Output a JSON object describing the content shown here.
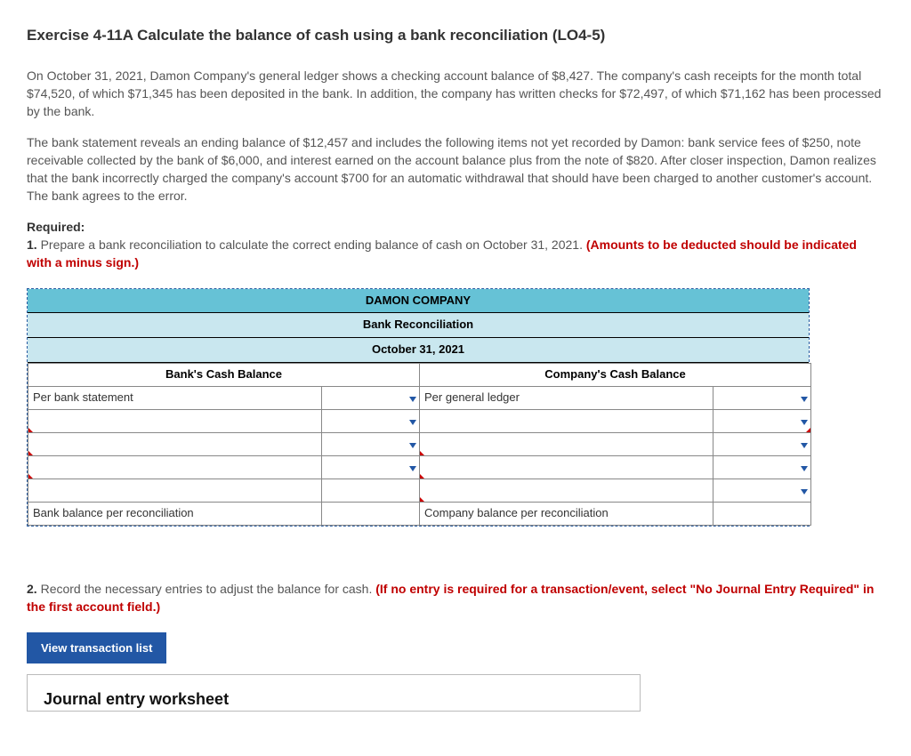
{
  "title": "Exercise 4-11A Calculate the balance of cash using a bank reconciliation (LO4-5)",
  "p1": "On October 31, 2021, Damon Company's general ledger shows a checking account balance of $8,427. The company's cash receipts for the month total $74,520, of which $71,345 has been deposited in the bank. In addition, the company has written checks for $72,497, of which $71,162 has been processed by the bank.",
  "p2": "The bank statement reveals an ending balance of $12,457 and includes the following items not yet recorded by Damon: bank service fees of $250, note receivable collected by the bank of $6,000, and interest earned on the account balance plus from the note of $820. After closer inspection, Damon realizes that the bank incorrectly charged the company's account $700 for an automatic withdrawal that should have been charged to another customer's account. The bank agrees to the error.",
  "required_label": "Required:",
  "req1_num": "1.",
  "req1_text": " Prepare a bank reconciliation to calculate the correct ending balance of cash on October 31, 2021. ",
  "req1_red": "(Amounts to be deducted should be indicated with a minus sign.)",
  "table": {
    "h1": "DAMON COMPANY",
    "h2": "Bank Reconciliation",
    "h3": "October 31, 2021",
    "col_bank": "Bank's Cash Balance",
    "col_company": "Company's Cash Balance",
    "row_bank_start": "Per bank statement",
    "row_company_start": "Per general ledger",
    "row_bank_end": "Bank balance per reconciliation",
    "row_company_end": "Company balance per reconciliation"
  },
  "req2_num": "2.",
  "req2_text": " Record the necessary entries to adjust the balance for cash. ",
  "req2_red": "(If no entry is required for a transaction/event, select \"No Journal Entry Required\" in the first account field.)",
  "btn_view": "View transaction list",
  "worksheet_title": "Journal entry worksheet"
}
